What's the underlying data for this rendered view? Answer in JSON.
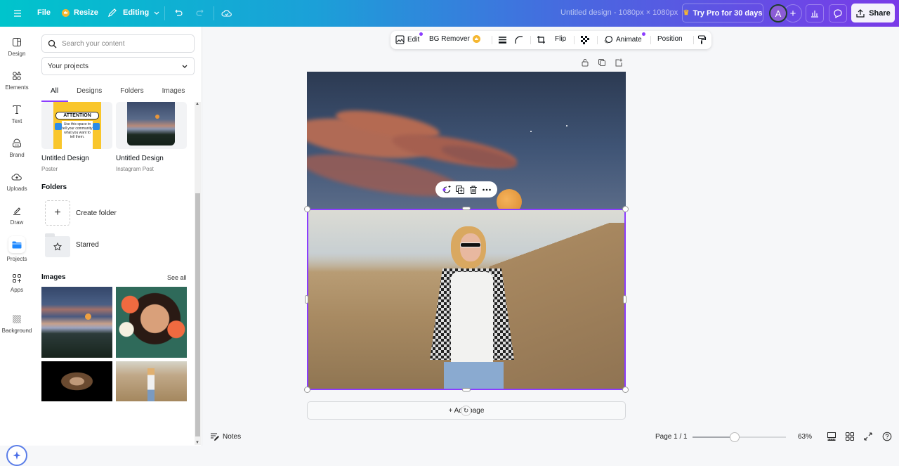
{
  "topbar": {
    "file": "File",
    "resize": "Resize",
    "editing": "Editing",
    "title": "Untitled design - 1080px × 1080px",
    "try_pro": "Try Pro for 30 days",
    "avatar_initial": "A",
    "share": "Share"
  },
  "rail": {
    "items": [
      {
        "label": "Design",
        "icon": "layout-icon"
      },
      {
        "label": "Elements",
        "icon": "shapes-icon"
      },
      {
        "label": "Text",
        "icon": "text-icon"
      },
      {
        "label": "Brand",
        "icon": "brand-icon"
      },
      {
        "label": "Uploads",
        "icon": "cloud-upload-icon"
      },
      {
        "label": "Draw",
        "icon": "pen-icon"
      },
      {
        "label": "Projects",
        "icon": "folder-icon",
        "active": true
      },
      {
        "label": "Apps",
        "icon": "apps-icon"
      },
      {
        "label": "Background",
        "icon": "background-icon"
      }
    ]
  },
  "panel": {
    "search_placeholder": "Search your content",
    "select_value": "Your projects",
    "tabs": [
      "All",
      "Designs",
      "Folders",
      "Images"
    ],
    "active_tab": "All",
    "designs": [
      {
        "title": "Untitled Design",
        "type": "Poster",
        "poster_heading": "ATTENTION",
        "poster_body": "Use this space to tell your community what you want to tell them."
      },
      {
        "title": "Untitled Design",
        "type": "Instagram Post"
      }
    ],
    "folders_heading": "Folders",
    "folders": [
      {
        "label": "Create folder"
      },
      {
        "label": "Starred"
      }
    ],
    "images_heading": "Images",
    "see_all": "See all",
    "images": [
      "mountain-moon",
      "woman-flowers-illustration",
      "girl-portrait",
      "woman-hillside"
    ]
  },
  "context_toolbar": {
    "edit": "Edit",
    "bg_remover": "BG Remover",
    "flip": "Flip",
    "animate": "Animate",
    "position": "Position"
  },
  "canvas": {
    "add_page": "+ Add page"
  },
  "footer": {
    "notes": "Notes",
    "page": "Page 1 / 1",
    "zoom": "63%",
    "zoom_fraction": 0.45
  },
  "colors": {
    "accent": "#8b3dff",
    "pro_crown": "#f5b731",
    "projects_blue": "#1e88ff"
  }
}
